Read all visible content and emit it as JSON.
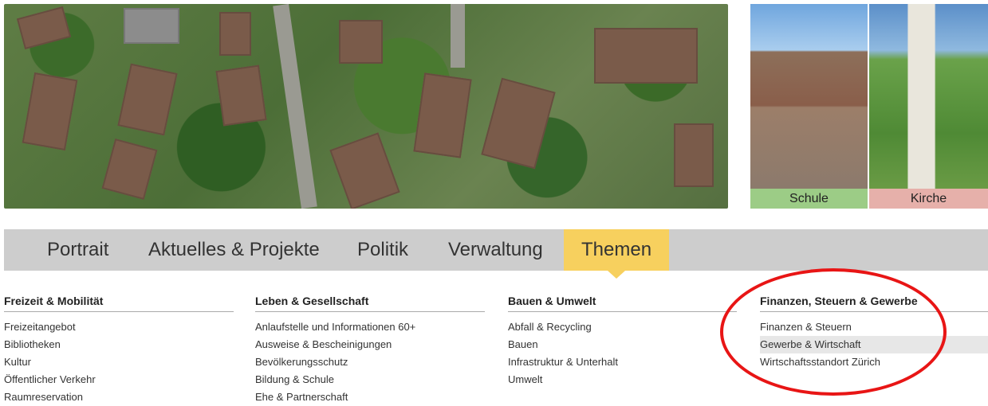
{
  "hero": {
    "captions": [
      "Schule",
      "Kirche"
    ]
  },
  "nav": {
    "items": [
      "Portrait",
      "Aktuelles & Projekte",
      "Politik",
      "Verwaltung",
      "Themen"
    ],
    "active": "Themen"
  },
  "columns": [
    {
      "title": "Freizeit & Mobilität",
      "items": [
        "Freizeitangebot",
        "Bibliotheken",
        "Kultur",
        "Öffentlicher Verkehr",
        "Raumreservation"
      ]
    },
    {
      "title": "Leben & Gesellschaft",
      "items": [
        "Anlaufstelle und Informationen 60+",
        "Ausweise & Bescheinigungen",
        "Bevölkerungsschutz",
        "Bildung & Schule",
        "Ehe & Partnerschaft"
      ]
    },
    {
      "title": "Bauen & Umwelt",
      "items": [
        "Abfall & Recycling",
        "Bauen",
        "Infrastruktur & Unterhalt",
        "Umwelt"
      ]
    },
    {
      "title": "Finanzen, Steuern & Gewerbe",
      "items": [
        "Finanzen & Steuern",
        "Gewerbe & Wirtschaft",
        "Wirtschaftsstandort Zürich"
      ],
      "highlighted": "Gewerbe & Wirtschaft"
    }
  ],
  "colors": {
    "active_tab": "#f7d05e",
    "nav_bg": "#cdcdcd",
    "annotation_circle": "#e81515",
    "schule_caption": "#9ccc86",
    "kirche_caption": "#e6b0aa"
  }
}
